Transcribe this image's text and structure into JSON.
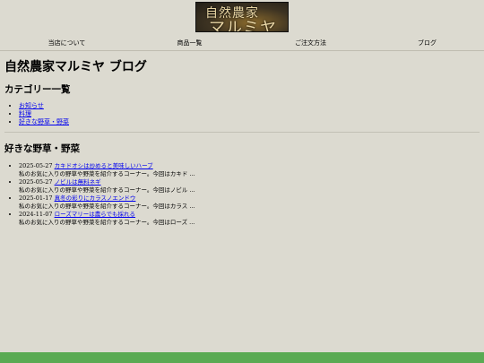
{
  "banner": {
    "line1": "自然農家",
    "line2": "マルミヤ"
  },
  "nav": [
    {
      "label": "当店について"
    },
    {
      "label": "商品一覧"
    },
    {
      "label": "ご注文方法"
    },
    {
      "label": "ブログ"
    }
  ],
  "page_title": "自然農家マルミヤ ブログ",
  "categories": {
    "heading": "カテゴリー一覧",
    "items": [
      {
        "label": "お知らせ"
      },
      {
        "label": "料理"
      },
      {
        "label": "好きな野草・野菜"
      }
    ]
  },
  "section": {
    "heading": "好きな野草・野菜",
    "posts": [
      {
        "date": "2025-05-27",
        "title": "カキドオシは炒めると美味しいハーブ",
        "excerpt": "私のお気に入りの野草や野菜を紹介するコーナー。今回はカキド ..."
      },
      {
        "date": "2025-05-27",
        "title": "ノビルは無料ネギ",
        "excerpt": "私のお気に入りの野草や野菜を紹介するコーナー。今回はノビル ..."
      },
      {
        "date": "2025-01-17",
        "title": "真冬の彩りにカラスノエンドウ",
        "excerpt": "私のお気に入りの野草や野菜を紹介するコーナー。今回はカラス ..."
      },
      {
        "date": "2024-11-07",
        "title": "ローズマリーは農らでも採れる",
        "excerpt": "私のお気に入りの野草や野菜を紹介するコーナー。今回はローズ ..."
      }
    ]
  },
  "colors": {
    "background": "#dcdad0",
    "footer": "#5aaa53",
    "link": "#0000ee"
  }
}
